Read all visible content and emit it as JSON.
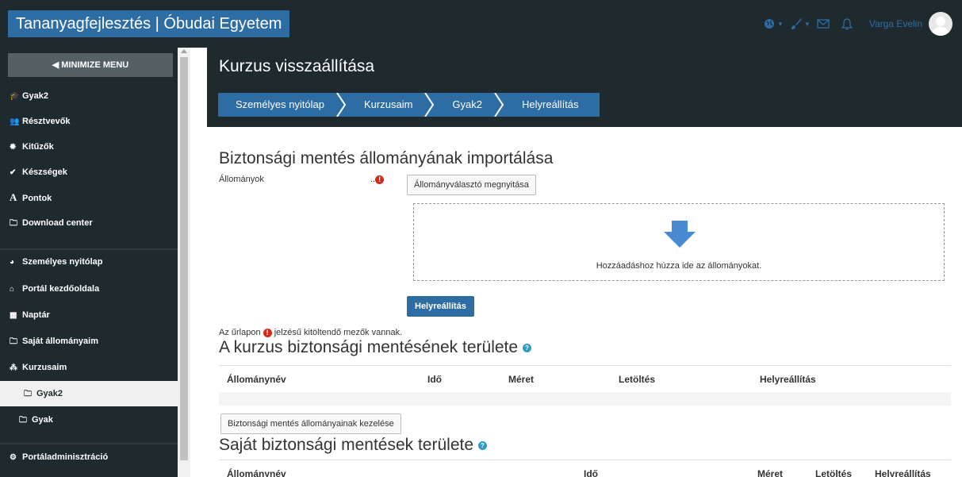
{
  "navbar": {
    "brand": "Tananyagfejlesztés | Óbudai Egyetem",
    "username": "Varga Evelin"
  },
  "sidebar": {
    "minimize_label": "MINIMIZE MENU",
    "items": [
      {
        "label": "Gyak2",
        "icon": "graduation-cap-icon"
      },
      {
        "label": "Résztvevők",
        "icon": "users-icon"
      },
      {
        "label": "Kitűzők",
        "icon": "badge-icon"
      },
      {
        "label": "Készségek",
        "icon": "check-circle-icon"
      },
      {
        "label": "Pontok",
        "icon": "font-a-icon"
      },
      {
        "label": "Download center",
        "icon": "folder-icon"
      },
      {
        "label": "Személyes nyitólap",
        "icon": "dashboard-icon"
      },
      {
        "label": "Portál kezdőoldala",
        "icon": "home-icon"
      },
      {
        "label": "Naptár",
        "icon": "calendar-icon"
      },
      {
        "label": "Saját állományaim",
        "icon": "folder-icon"
      },
      {
        "label": "Kurzusaim",
        "icon": "sitemap-icon"
      },
      {
        "label": "Gyak2",
        "icon": "folder-icon"
      },
      {
        "label": "Gyak",
        "icon": "folder-icon"
      },
      {
        "label": "Portáladminisztráció",
        "icon": "cogs-icon"
      }
    ]
  },
  "header": {
    "title": "Kurzus visszaállítása",
    "breadcrumb": [
      "Személyes nyitólap",
      "Kurzusaim",
      "Gyak2",
      "Helyreállítás"
    ]
  },
  "import": {
    "heading": "Biztonsági mentés állományának importálása",
    "files_label": "Állományok",
    "file_picker_button": "Állományválasztó megnyitása",
    "dropzone_text": "Hozzáadáshoz húzza ide az állományokat.",
    "restore_button": "Helyreállítás",
    "required_note_before": "Az űrlapon",
    "required_note_after": "jelzésű kitöltendő mezők vannak."
  },
  "course_backup": {
    "heading": "A kurzus biztonsági mentésének területe",
    "columns": [
      "Állománynév",
      "Idő",
      "Méret",
      "Letöltés",
      "Helyreállítás"
    ],
    "manage_button": "Biztonsági mentés állományainak kezelése"
  },
  "user_backup": {
    "heading": "Saját biztonsági mentések területe",
    "columns": [
      "Állománynév",
      "Idő",
      "Méret",
      "Letöltés",
      "Helyreállítás"
    ]
  },
  "colors": {
    "dark": "#1f2a2e",
    "primary": "#2e6da4",
    "required": "#d42a1c",
    "help": "#2e9bbf"
  }
}
